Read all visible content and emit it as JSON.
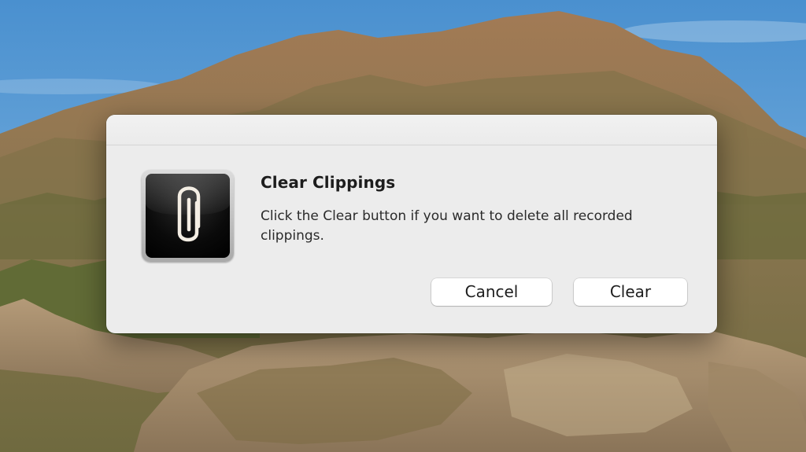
{
  "dialog": {
    "title": "Clear Clippings",
    "message": "Click the Clear button if you want to delete all recorded clippings.",
    "app_icon": "paperclip-icon",
    "buttons": {
      "cancel_label": "Cancel",
      "clear_label": "Clear"
    }
  },
  "desktop": {
    "wallpaper": "catalina-island-wallpaper"
  },
  "colors": {
    "dialog_background": "#ececec",
    "button_background": "#ffffff",
    "text": "#1d1d1d"
  }
}
